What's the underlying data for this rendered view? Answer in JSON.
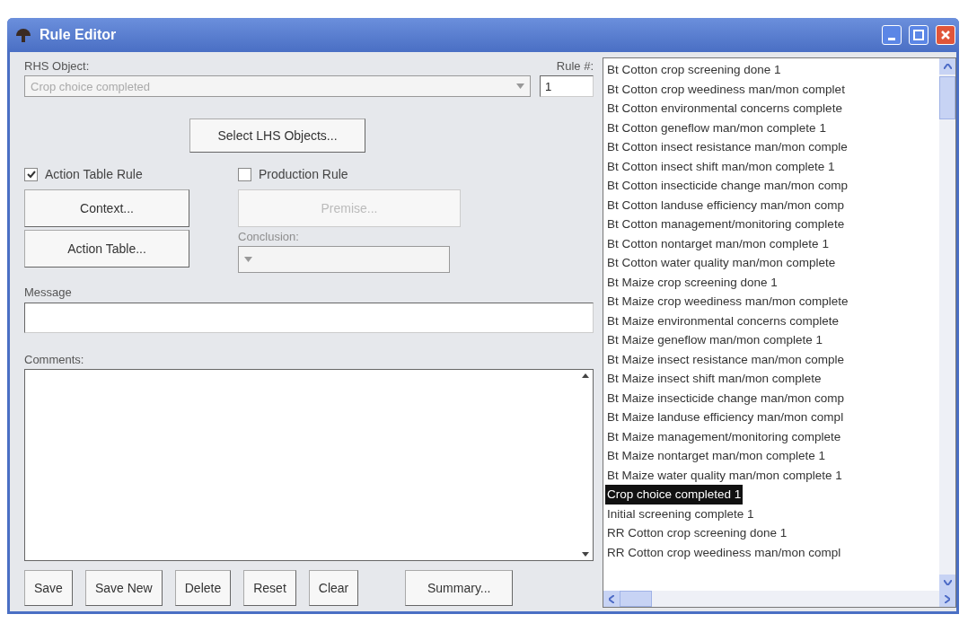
{
  "window": {
    "title": "Rule Editor"
  },
  "rhs_object": {
    "label": "RHS Object:",
    "value": "Crop choice completed",
    "disabled": true
  },
  "rule_number": {
    "label": "Rule #:",
    "value": "1"
  },
  "select_lhs_button": "Select LHS Objects...",
  "action_table_rule": {
    "label": "Action Table Rule",
    "checked": true,
    "buttons": [
      "Context...",
      "Action Table..."
    ]
  },
  "production_rule": {
    "label": "Production Rule",
    "checked": false,
    "premise_button": "Premise...",
    "conclusion_label": "Conclusion:",
    "disabled": true
  },
  "message": {
    "label": "Message"
  },
  "comments": {
    "label": "Comments:"
  },
  "bottom_buttons": [
    "Save",
    "Save New",
    "Delete",
    "Reset",
    "Clear",
    "Summary..."
  ],
  "object_list": [
    {
      "label": "Bt Cotton crop screening done 1",
      "selected": false
    },
    {
      "label": "Bt Cotton crop weediness man/mon complet",
      "selected": false
    },
    {
      "label": "Bt Cotton environmental concerns complete",
      "selected": false
    },
    {
      "label": "Bt Cotton geneflow man/mon complete 1",
      "selected": false
    },
    {
      "label": "Bt Cotton insect resistance man/mon comple",
      "selected": false
    },
    {
      "label": "Bt Cotton insect shift man/mon complete 1",
      "selected": false
    },
    {
      "label": "Bt Cotton insecticide change man/mon comp",
      "selected": false
    },
    {
      "label": "Bt Cotton landuse efficiency man/mon comp",
      "selected": false
    },
    {
      "label": "Bt Cotton management/monitoring complete",
      "selected": false
    },
    {
      "label": "Bt Cotton nontarget man/mon complete 1",
      "selected": false
    },
    {
      "label": "Bt Cotton water quality man/mon complete",
      "selected": false
    },
    {
      "label": "Bt Maize crop screening done 1",
      "selected": false
    },
    {
      "label": "Bt Maize crop weediness man/mon complete",
      "selected": false
    },
    {
      "label": "Bt Maize environmental concerns complete",
      "selected": false
    },
    {
      "label": "Bt Maize geneflow man/mon complete 1",
      "selected": false
    },
    {
      "label": "Bt Maize insect resistance man/mon comple",
      "selected": false
    },
    {
      "label": "Bt Maize insect shift man/mon complete",
      "selected": false
    },
    {
      "label": "Bt Maize insecticide change man/mon comp",
      "selected": false
    },
    {
      "label": "Bt Maize landuse efficiency man/mon compl",
      "selected": false
    },
    {
      "label": "Bt Maize management/monitoring complete",
      "selected": false
    },
    {
      "label": "Bt Maize nontarget man/mon complete 1",
      "selected": false
    },
    {
      "label": "Bt Maize water quality man/mon complete 1",
      "selected": false
    },
    {
      "label": "Crop choice completed 1",
      "selected": true
    },
    {
      "label": "Initial screening complete 1",
      "selected": false
    },
    {
      "label": "RR Cotton crop screening done 1",
      "selected": false
    },
    {
      "label": "RR Cotton crop weediness man/mon compl",
      "selected": false
    }
  ]
}
